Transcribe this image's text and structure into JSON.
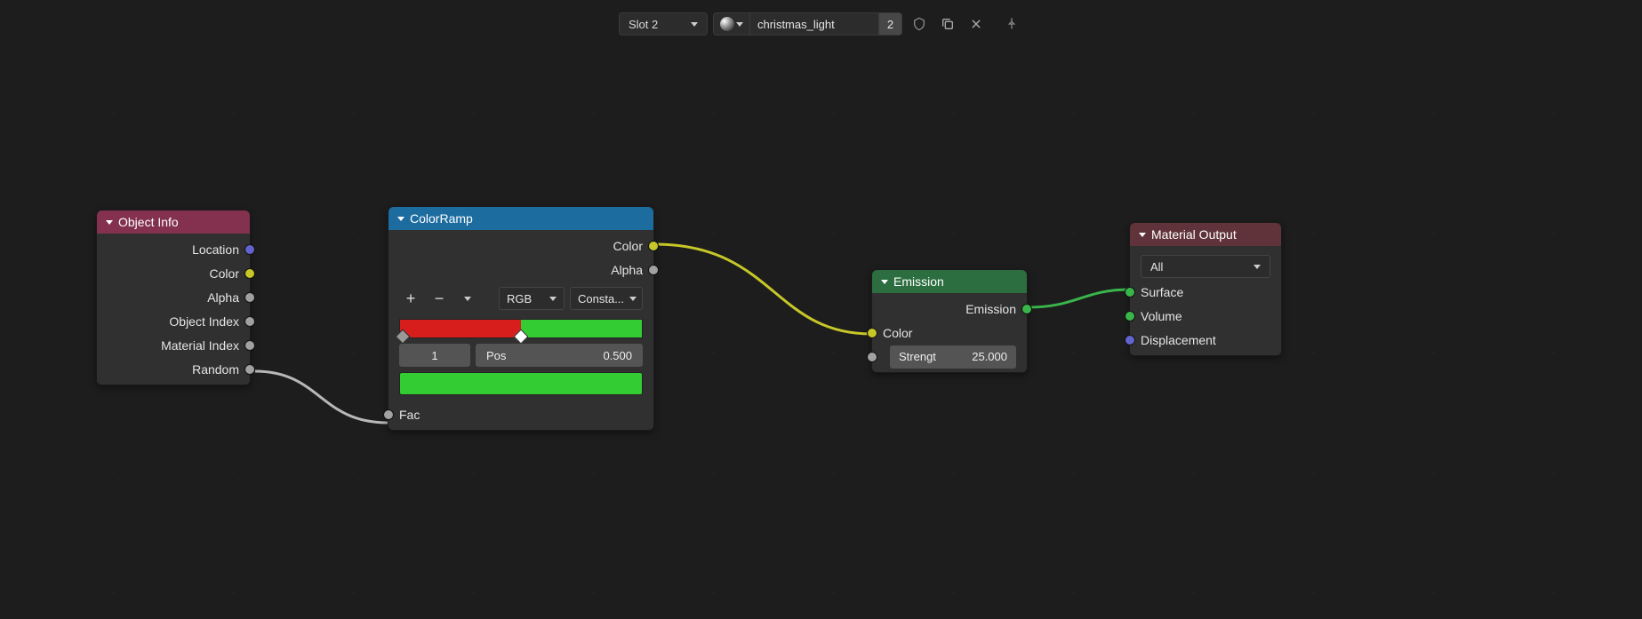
{
  "header": {
    "slot_label": "Slot 2",
    "material_name": "christmas_light",
    "users": "2"
  },
  "nodes": {
    "object_info": {
      "title": "Object Info",
      "outputs": {
        "location": "Location",
        "color": "Color",
        "alpha": "Alpha",
        "object_index": "Object Index",
        "material_index": "Material Index",
        "random": "Random"
      }
    },
    "color_ramp": {
      "title": "ColorRamp",
      "outputs": {
        "color": "Color",
        "alpha": "Alpha"
      },
      "mode": "RGB",
      "interp": "Consta...",
      "stop_index": "1",
      "pos_label": "Pos",
      "pos_value": "0.500",
      "inputs": {
        "fac": "Fac"
      }
    },
    "emission": {
      "title": "Emission",
      "outputs": {
        "emission": "Emission"
      },
      "inputs": {
        "color": "Color",
        "strength_label": "Strengt",
        "strength_value": "25.000"
      }
    },
    "material_output": {
      "title": "Material Output",
      "target": "All",
      "inputs": {
        "surface": "Surface",
        "volume": "Volume",
        "displacement": "Displacement"
      }
    }
  }
}
